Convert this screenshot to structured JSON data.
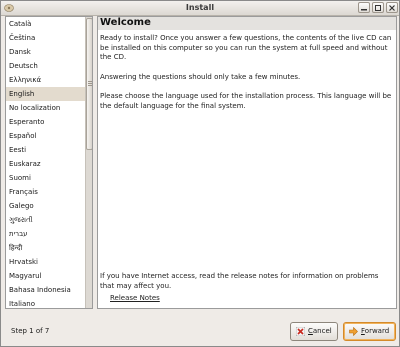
{
  "window": {
    "title": "Install"
  },
  "languages": {
    "items": [
      "Català",
      "Čeština",
      "Dansk",
      "Deutsch",
      "Ελληνικά",
      "English",
      "No localization",
      "Esperanto",
      "Español",
      "Eesti",
      "Euskaraz",
      "Suomi",
      "Français",
      "Galego",
      "ગુજરાતી",
      "עברית",
      "हिन्दी",
      "Hrvatski",
      "Magyarul",
      "Bahasa Indonesia",
      "Italiano"
    ],
    "selected": "English"
  },
  "welcome": {
    "title": "Welcome",
    "para1": "Ready to install? Once you answer a few questions, the contents of the live CD can be installed on this computer so you can run the system at full speed and without the CD.",
    "para2": "Answering the questions should only take a few minutes.",
    "para3": "Please choose the language used for the installation process. This language will be the default language for the final system.",
    "para4": "If you have Internet access, read the release notes for information on problems that may affect you.",
    "release_notes_link": "Release Notes"
  },
  "footer": {
    "step": "Step 1 of 7",
    "cancel_label": "Cancel",
    "forward_label": "Forward"
  },
  "colors": {
    "selected_row": "#e3dbce",
    "forward_border": "#d48a2a"
  }
}
